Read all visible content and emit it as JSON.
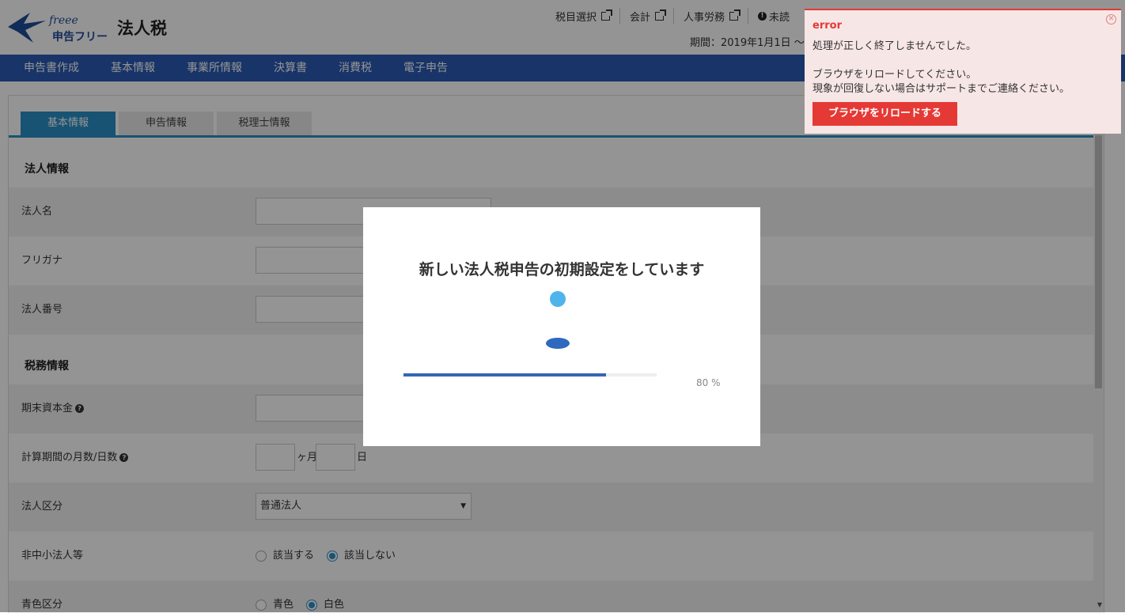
{
  "header": {
    "logo_freee": "freee",
    "logo_name": "申告フリー",
    "product_title": "法人税",
    "links": [
      {
        "label": "税目選択",
        "external": true
      },
      {
        "label": "会計",
        "external": true
      },
      {
        "label": "人事労務",
        "external": true
      },
      {
        "label": "未読",
        "external": false
      }
    ],
    "period": "期間：2019年1月1日 〜"
  },
  "nav": {
    "items": [
      "申告書作成",
      "基本情報",
      "事業所情報",
      "決算書",
      "消費税",
      "電子申告"
    ]
  },
  "tabs": [
    {
      "label": "基本情報",
      "active": true
    },
    {
      "label": "申告情報",
      "active": false
    },
    {
      "label": "税理士情報",
      "active": false
    }
  ],
  "sections": {
    "corporate": "法人情報",
    "tax": "税務情報"
  },
  "fields": {
    "corp_name": "法人名",
    "furigana": "フリガナ",
    "corp_number": "法人番号",
    "capital": "期末資本金",
    "period_months_days": "計算期間の月数/日数",
    "month_unit": "ヶ月",
    "day_unit": "日",
    "corp_class": "法人区分",
    "corp_class_value": "普通法人",
    "non_sme": "非中小法人等",
    "non_sme_yes": "該当する",
    "non_sme_no": "該当しない",
    "blue_return": "青色区分",
    "blue_option": "青色",
    "white_option": "白色"
  },
  "modal": {
    "title": "新しい法人税申告の初期設定をしています",
    "progress": 80,
    "progress_text": "80 %"
  },
  "toast": {
    "title": "error",
    "message1": "処理が正しく終了しませんでした。",
    "message2": "ブラウザをリロードしてください。",
    "message3": "現象が回復しない場合はサポートまでご連絡ください。",
    "button": "ブラウザをリロードする"
  },
  "colors": {
    "nav": "#2a5bb4",
    "tab_active": "#2a8fc7",
    "error": "#e53935",
    "toast_bg": "#f7e6e6"
  }
}
